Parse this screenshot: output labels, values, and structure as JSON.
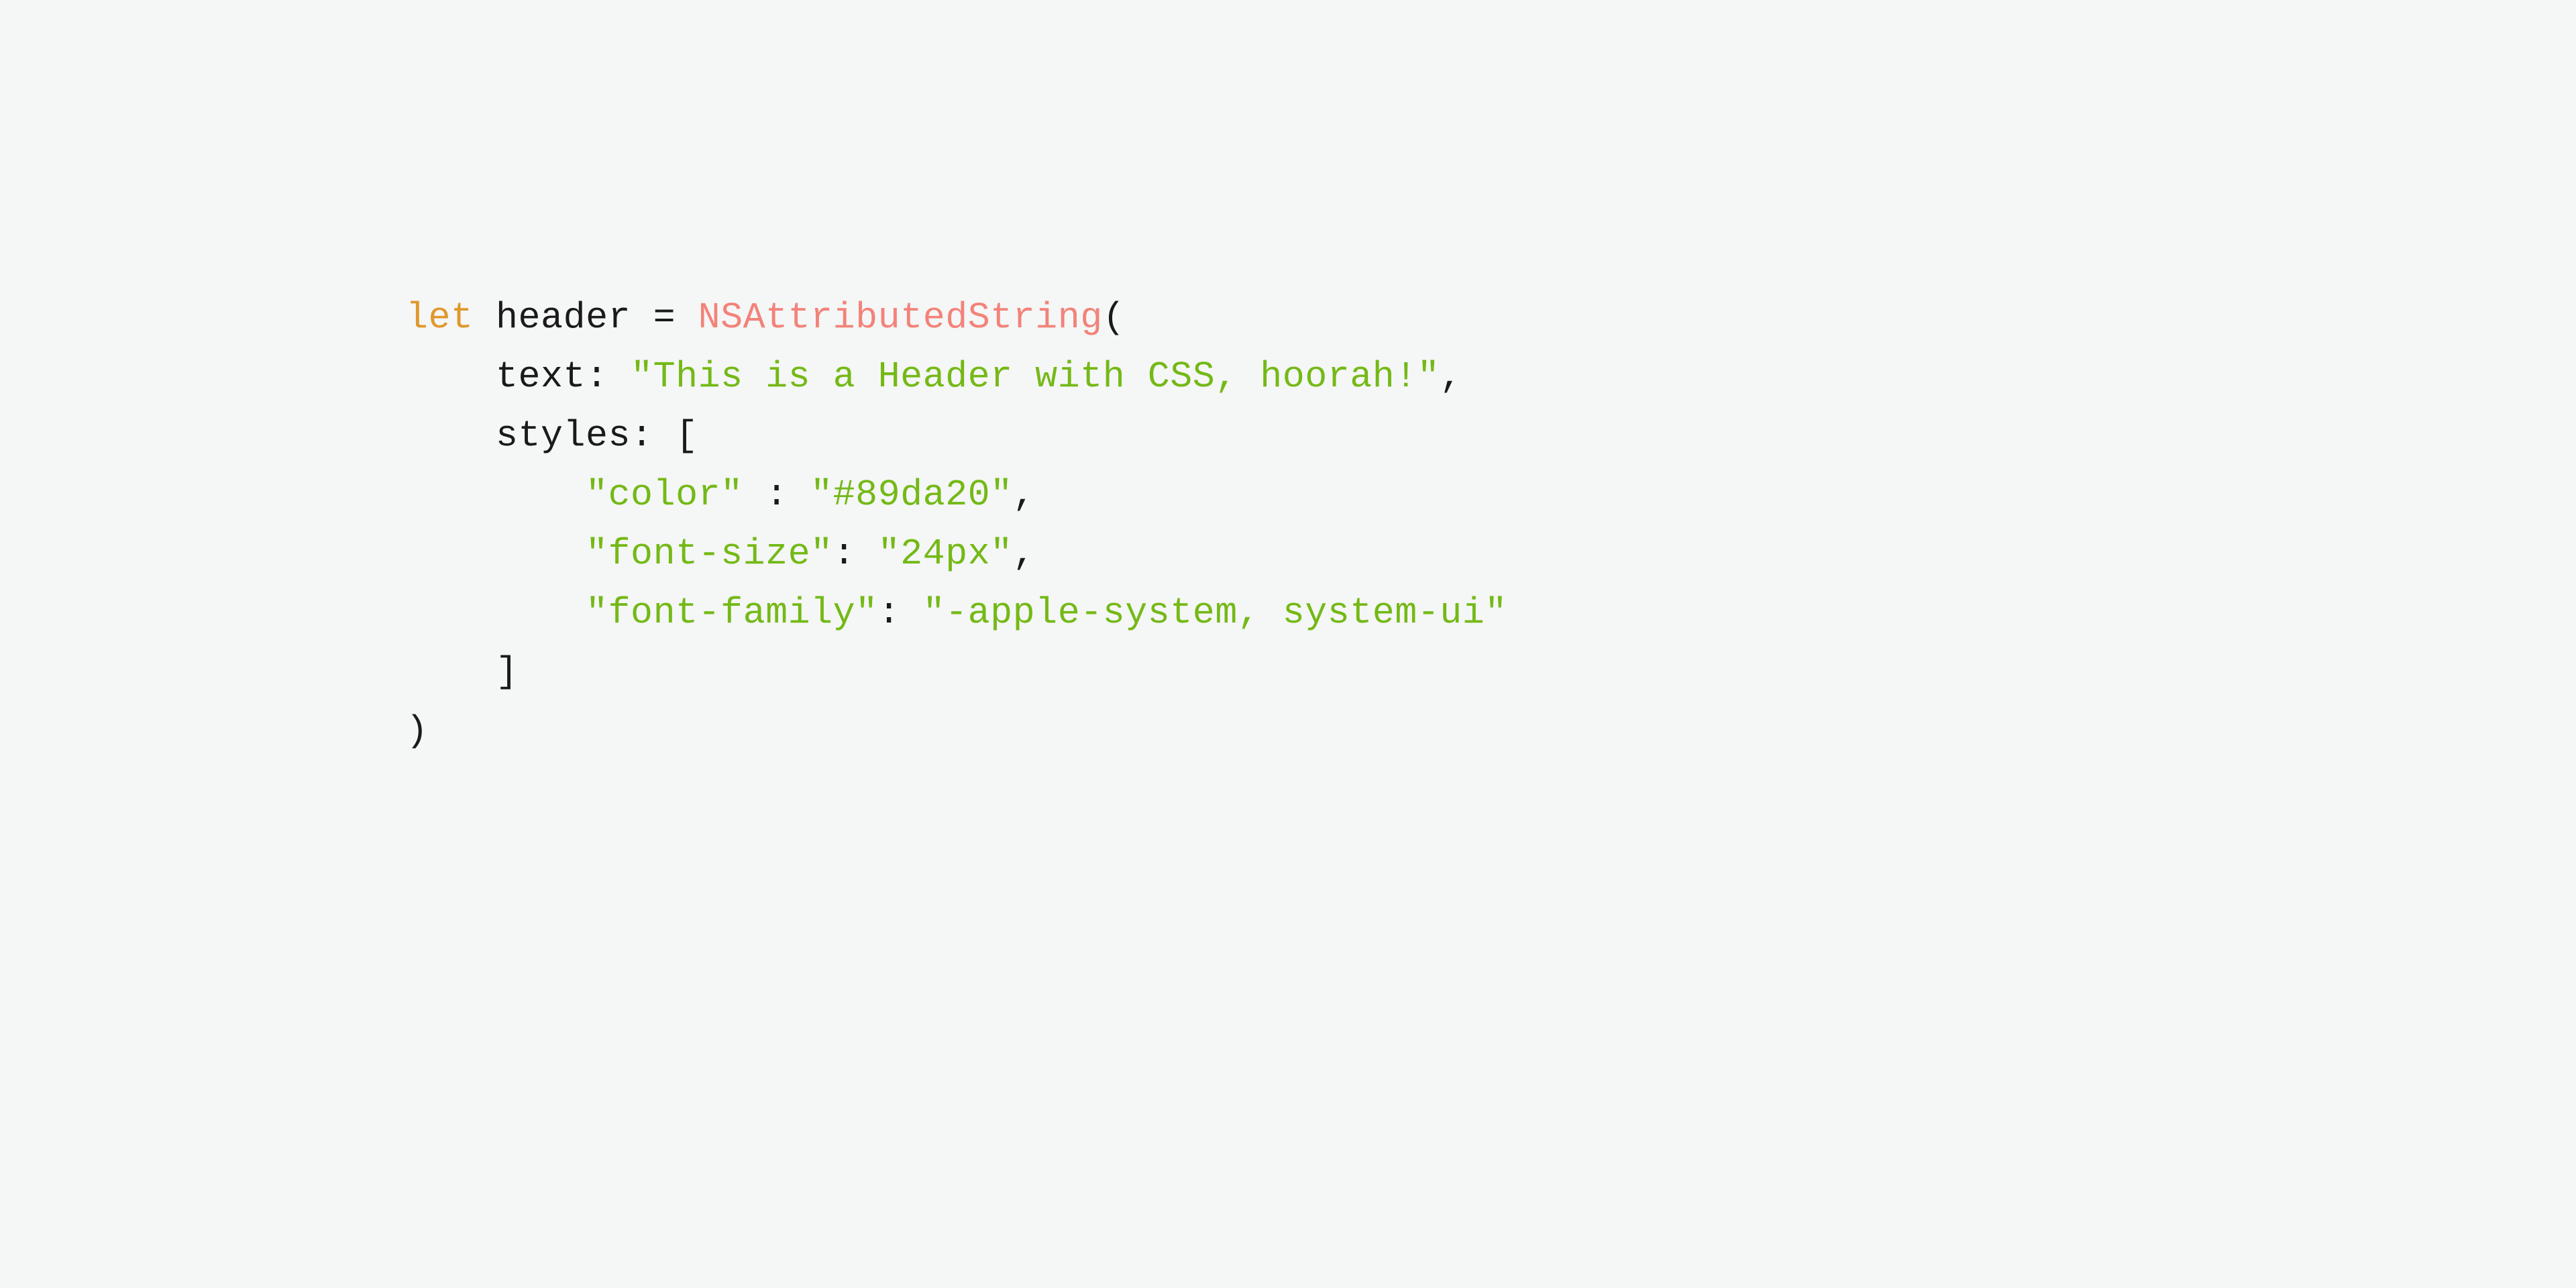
{
  "code": {
    "colors": {
      "keyword": "#e0982c",
      "default": "#1a1a1a",
      "type": "#f2837a",
      "string": "#74b916",
      "background": "#f5f6f6"
    },
    "line1": {
      "keyword": "let",
      "sp1": " ",
      "var": "header",
      "sp2": " ",
      "eq": "=",
      "sp3": " ",
      "type": "NSAttributedString",
      "paren": "("
    },
    "line2": {
      "indent": "    ",
      "label": "text:",
      "sp": " ",
      "string": "\"This is a Header with CSS, hoorah!\"",
      "comma": ","
    },
    "line3": {
      "indent": "    ",
      "label": "styles:",
      "sp": " ",
      "bracket": "["
    },
    "line4": {
      "indent": "        ",
      "key": "\"color\"",
      "sp1": " ",
      "colon": ":",
      "sp2": " ",
      "val": "\"#89da20\"",
      "comma": ","
    },
    "line5": {
      "indent": "        ",
      "key": "\"font-size\"",
      "colon": ":",
      "sp": " ",
      "val": "\"24px\"",
      "comma": ","
    },
    "line6": {
      "indent": "        ",
      "key": "\"font-family\"",
      "colon": ":",
      "sp": " ",
      "val": "\"-apple-system, system-ui\""
    },
    "line7": {
      "indent": "    ",
      "bracket": "]"
    },
    "line8": {
      "paren": ")"
    }
  }
}
